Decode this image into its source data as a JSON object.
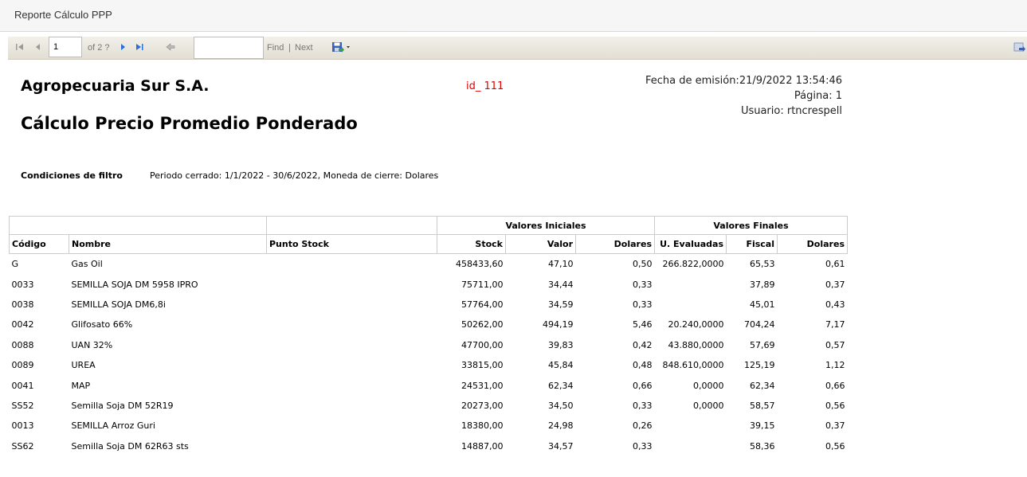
{
  "window": {
    "title": "Reporte Cálculo PPP"
  },
  "toolbar": {
    "page_value": "1",
    "page_of": "of 2 ?",
    "find_label": "Find",
    "separator": "|",
    "next_label": "Next",
    "find_value": ""
  },
  "report": {
    "company": "Agropecuaria Sur S.A.",
    "title": "Cálculo Precio Promedio Ponderado",
    "id": "id_ 111",
    "fecha": "Fecha de emisión:21/9/2022 13:54:46",
    "pagina": "Página: 1",
    "usuario": "Usuario: rtncrespell",
    "filter_label": "Condiciones de filtro",
    "filter_value": "Periodo cerrado: 1/1/2022 - 30/6/2022, Moneda de cierre: Dolares"
  },
  "table": {
    "group_headers": {
      "iniciales": "Valores Iniciales",
      "finales": "Valores Finales"
    },
    "columns": [
      "Código",
      "Nombre",
      "Punto Stock",
      "Stock",
      "Valor",
      "Dolares",
      "U. Evaluadas",
      "Fiscal",
      "Dolares"
    ],
    "rows": [
      [
        "G",
        "Gas Oil",
        "",
        "458433,60",
        "47,10",
        "0,50",
        "266.822,0000",
        "65,53",
        "0,61"
      ],
      [
        "0033",
        "SEMILLA SOJA DM 5958 IPRO",
        "",
        "75711,00",
        "34,44",
        "0,33",
        "",
        "37,89",
        "0,37"
      ],
      [
        "0038",
        "SEMILLA SOJA DM6,8i",
        "",
        "57764,00",
        "34,59",
        "0,33",
        "",
        "45,01",
        "0,43"
      ],
      [
        "0042",
        "Glifosato 66%",
        "",
        "50262,00",
        "494,19",
        "5,46",
        "20.240,0000",
        "704,24",
        "7,17"
      ],
      [
        "0088",
        "UAN 32%",
        "",
        "47700,00",
        "39,83",
        "0,42",
        "43.880,0000",
        "57,69",
        "0,57"
      ],
      [
        "0089",
        "UREA",
        "",
        "33815,00",
        "45,84",
        "0,48",
        "848.610,0000",
        "125,19",
        "1,12"
      ],
      [
        "0041",
        "MAP",
        "",
        "24531,00",
        "62,34",
        "0,66",
        "0,0000",
        "62,34",
        "0,66"
      ],
      [
        "SS52",
        "Semilla Soja DM 52R19",
        "",
        "20273,00",
        "34,50",
        "0,33",
        "0,0000",
        "58,57",
        "0,56"
      ],
      [
        "0013",
        "SEMILLA Arroz Guri",
        "",
        "18380,00",
        "24,98",
        "0,26",
        "",
        "39,15",
        "0,37"
      ],
      [
        "SS62",
        "Semilla Soja DM 62R63 sts",
        "",
        "14887,00",
        "34,57",
        "0,33",
        "",
        "58,36",
        "0,56"
      ]
    ]
  },
  "colors": {
    "accent_red": "#e00000",
    "toolbar_bg": "#e8e5dc",
    "nav_blue": "#2a6fd6"
  }
}
